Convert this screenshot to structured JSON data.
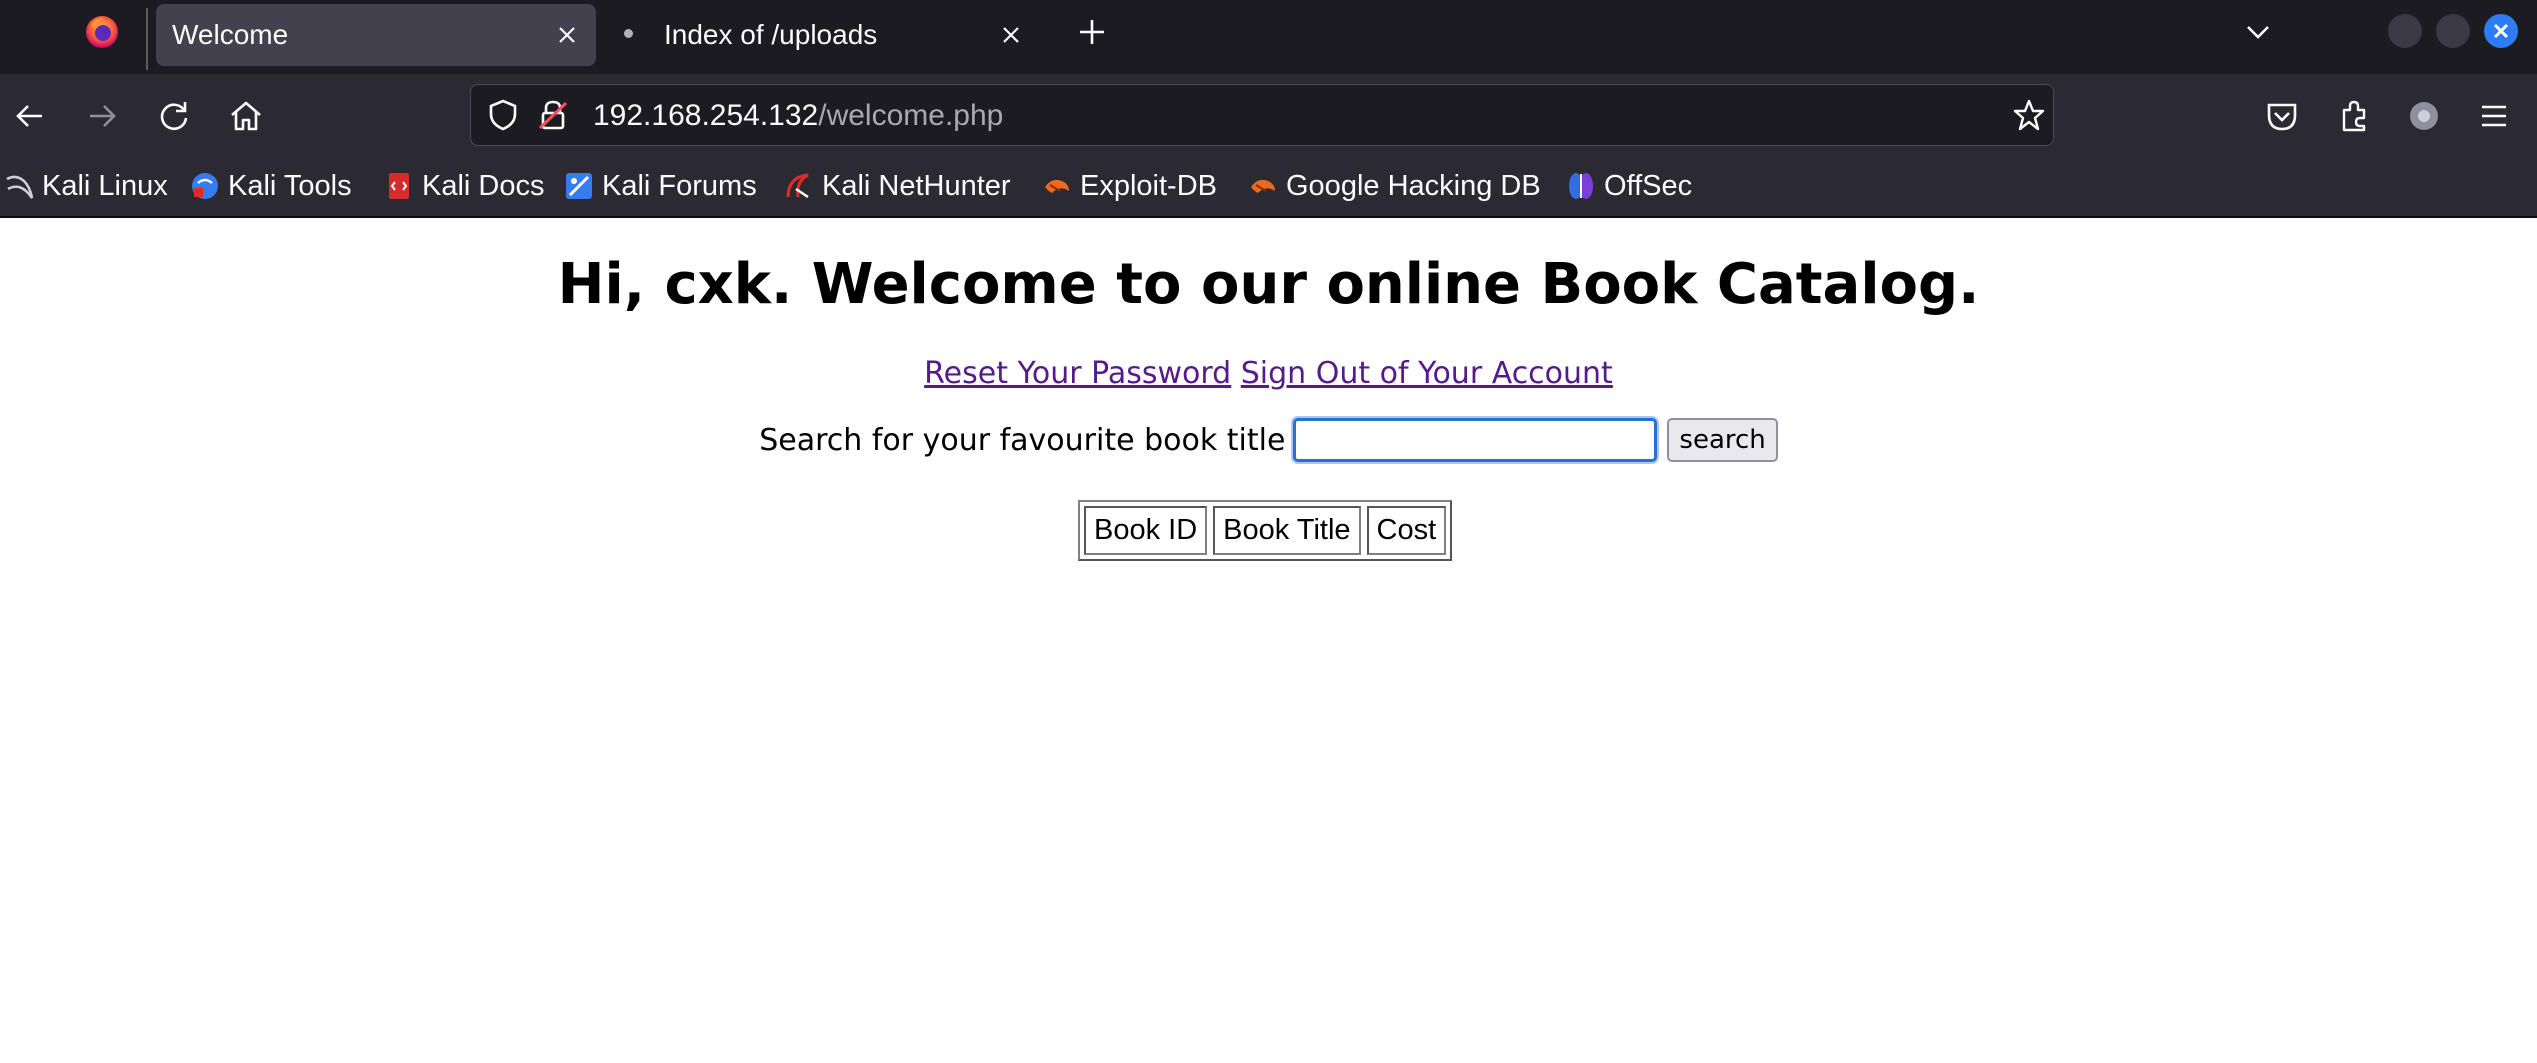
{
  "browser": {
    "tabs": [
      {
        "title": "Welcome",
        "active": true
      },
      {
        "title": "Index of /uploads",
        "active": false
      }
    ],
    "url": {
      "host": "192.168.254.132",
      "path": "/welcome.php"
    },
    "bookmarks": [
      {
        "label": "Kali Linux",
        "icon": "kali-dragon-icon"
      },
      {
        "label": "Kali Tools",
        "icon": "kali-tools-icon"
      },
      {
        "label": "Kali Docs",
        "icon": "kali-docs-icon"
      },
      {
        "label": "Kali Forums",
        "icon": "kali-forums-icon"
      },
      {
        "label": "Kali NetHunter",
        "icon": "kali-nethunter-icon"
      },
      {
        "label": "Exploit-DB",
        "icon": "exploit-db-icon"
      },
      {
        "label": "Google Hacking DB",
        "icon": "google-hacking-db-icon"
      },
      {
        "label": "OffSec",
        "icon": "offsec-icon"
      }
    ],
    "colors": {
      "chrome_dark": "#1c1b22",
      "chrome": "#2b2a33",
      "active_tab": "#42414d",
      "close_accent": "#2d7cf5"
    }
  },
  "page": {
    "heading": "Hi, cxk. Welcome to our online Book Catalog.",
    "links": {
      "reset": "Reset Your Password",
      "signout": "Sign Out of Your Account"
    },
    "search": {
      "label": "Search for your favourite book title",
      "value": "",
      "button": "search"
    },
    "table": {
      "headers": [
        "Book ID",
        "Book Title",
        "Cost"
      ]
    },
    "colors": {
      "link": "#551a8b",
      "focus_ring": "#2a6fd6"
    }
  }
}
